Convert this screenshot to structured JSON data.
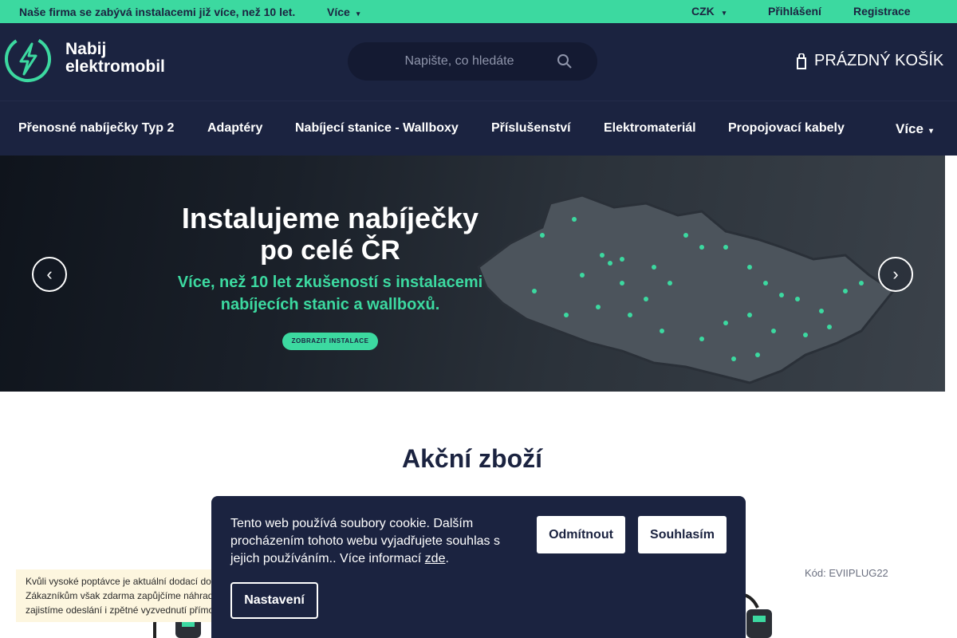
{
  "topbar": {
    "message": "Naše firma se zabývá instalacemi již více, než 10 let.",
    "more_label": "Více",
    "currency": "CZK",
    "login": "Přihlášení",
    "register": "Registrace"
  },
  "header": {
    "logo_line1": "Nabij",
    "logo_line2": "elektromobil",
    "search_placeholder": "Napište, co hledáte",
    "cart_label": "PRÁZDNÝ KOŠÍK"
  },
  "nav": {
    "items": [
      "Přenosné nabíječky Typ 2",
      "Adaptéry",
      "Nabíjecí stanice - Wallboxy",
      "Příslušenství",
      "Elektromateriál",
      "Propojovací kabely"
    ],
    "more_label": "Více"
  },
  "banner": {
    "heading_line1": "Instalujeme nabíječky",
    "heading_line2": "po celé ČR",
    "sub_line1": "Více, než 10 let zkušeností s instalacemi",
    "sub_line2": "nabíjecích stanic a wallboxů.",
    "cta": "ZOBRAZIT INSTALACE"
  },
  "section": {
    "title": "Akční zboží",
    "product_code": "Kód: EVIIPLUG22"
  },
  "notice": {
    "text": "Kvůli vysoké poptávce je aktuální dodací do... Zákazníkům však zdarma zapůjčíme náhrad... zajistíme odeslání i zpětné vyzvednutí přímo..."
  },
  "cookie": {
    "text": "Tento web používá soubory cookie. Dalším procházením tohoto webu vyjadřujete souhlas s jejich používáním.. Více informací",
    "link": "zde",
    "link_suffix": ".",
    "reject": "Odmítnout",
    "accept": "Souhlasím",
    "settings": "Nastavení"
  },
  "colors": {
    "accent": "#3cd9a0",
    "navy": "#1b2340"
  }
}
